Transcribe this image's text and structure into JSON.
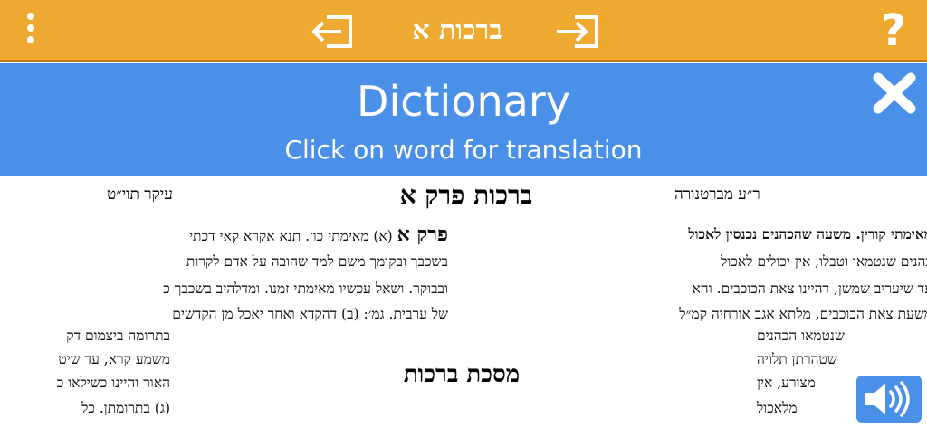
{
  "topbar": {
    "title": "ברכות א",
    "help_label": "?",
    "menu_icon": "more-vertical-icon",
    "prev_icon": "exit-left-icon",
    "next_icon": "enter-right-icon",
    "background": "#eeaa30"
  },
  "dictionary": {
    "title": "Dictionary",
    "subtitle": "Click on word for translation",
    "close_icon": "close-icon",
    "background": "#4a8fe8"
  },
  "page": {
    "header_left": "עיקר תוי״ט",
    "header_center": "ברכות פרק א",
    "header_right": "ר״ע מברטנורה",
    "tractate_title": "מסכת ברכות",
    "left_column": {
      "chapter_label": "פרק א",
      "lines": [
        "(א) מאימתי כו׳. תנא אקרא קאי דכתי",
        "בשכבך ובקומך משם למד שהובה על אדם לקרות",
        "ובבוקר. ושאל עכשיו מאימתי זמנו. ומדלהיב בשכבך כ",
        "של ערבית. גמ׳: (ב) דהקדא ואחר יאכל מן הקדשים",
        "בתרומה ביצמום דק",
        "משמע קרא, עד שיט",
        "האור והיינו כשילאו כ",
        "(ג) בתרומתן. כל"
      ]
    },
    "right_column": {
      "lead_bold": "מאימתי קורין. משעה שהכהנים נכנסין לאכול",
      "lines": [
        "כהנים שנטמאו וטבלו, אין יכולים לאכול",
        "עד שיעריב שמשן, דהיינו צאת הכוכבים. והא",
        "משעת צאת הכוכבים, מלתא אגב אורחיה קמ״ל",
        "שנטמאו הכהנים",
        "שטהרתן תלויה",
        "מצורע, אין",
        "מלאכול"
      ]
    },
    "speaker_icon": "speaker-volume-icon"
  }
}
